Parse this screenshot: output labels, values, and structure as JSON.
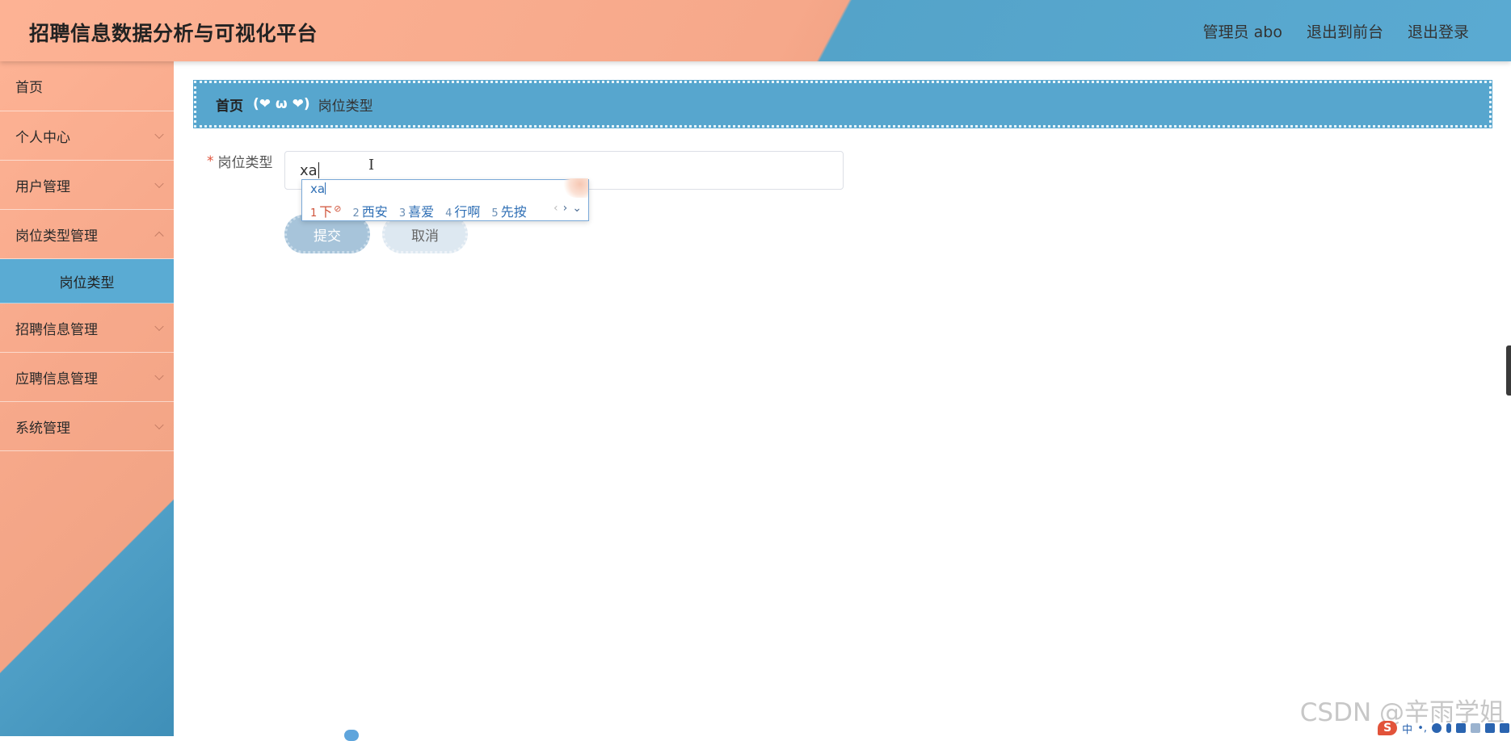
{
  "header": {
    "title": "招聘信息数据分析与可视化平台",
    "user": "管理员 abo",
    "to_front": "退出到前台",
    "logout": "退出登录"
  },
  "sidebar": {
    "items": [
      {
        "label": "首页"
      },
      {
        "label": "个人中心"
      },
      {
        "label": "用户管理"
      },
      {
        "label": "岗位类型管理"
      },
      {
        "label": "招聘信息管理"
      },
      {
        "label": "应聘信息管理"
      },
      {
        "label": "系统管理"
      }
    ],
    "active_sub": "岗位类型"
  },
  "breadcrumb": {
    "home": "首页",
    "separator": "(❤ ω ❤)",
    "current": "岗位类型"
  },
  "form": {
    "required_mark": "*",
    "label": "岗位类型",
    "value": "xa",
    "submit": "提交",
    "cancel": "取消"
  },
  "ime": {
    "composition": "xa",
    "candidates": [
      {
        "n": "1",
        "text": "下"
      },
      {
        "n": "2",
        "text": "西安"
      },
      {
        "n": "3",
        "text": "喜爱"
      },
      {
        "n": "4",
        "text": "行啊"
      },
      {
        "n": "5",
        "text": "先按"
      }
    ]
  },
  "watermark": "CSDN @辛雨学姐",
  "tray": {
    "logo": "S",
    "mode": "中"
  },
  "colors": {
    "peach": "#fdb294",
    "blue": "#57a6ce"
  }
}
